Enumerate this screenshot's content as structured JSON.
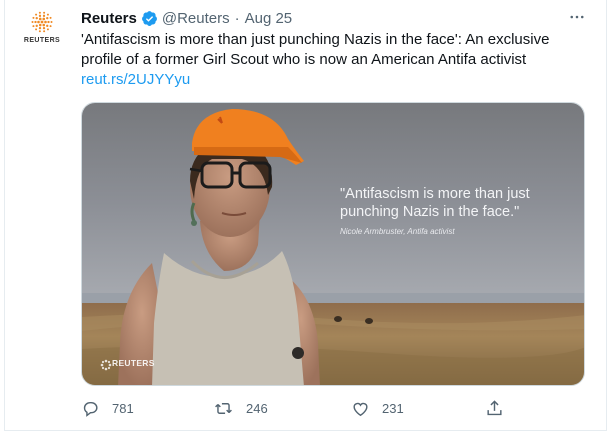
{
  "tweet": {
    "author_name": "Reuters",
    "handle": "@Reuters",
    "separator": "·",
    "date": "Aug 25",
    "text": "'Antifascism is more than just punching Nazis in the face': An exclusive profile of a former Girl Scout who is now an American Antifa activist",
    "link": "reut.rs/2UJYYyu"
  },
  "avatar": {
    "wordmark": "REUTERS"
  },
  "media": {
    "quote": "\"Antifascism is more than just punching Nazis in the face.\"",
    "attribution": "Nicole Armbruster, Antifa activist",
    "watermark": "REUTERS"
  },
  "actions": {
    "replies": "781",
    "retweets": "246",
    "likes": "231"
  },
  "icons": {
    "verified": "verified-badge-icon",
    "more": "more-options-icon",
    "reply": "reply-icon",
    "retweet": "retweet-icon",
    "like": "heart-icon",
    "share": "share-icon"
  },
  "colors": {
    "accent": "#1d9bf0",
    "text": "#0f1419",
    "muted": "#536471",
    "reuters_orange": "#f08a24"
  }
}
